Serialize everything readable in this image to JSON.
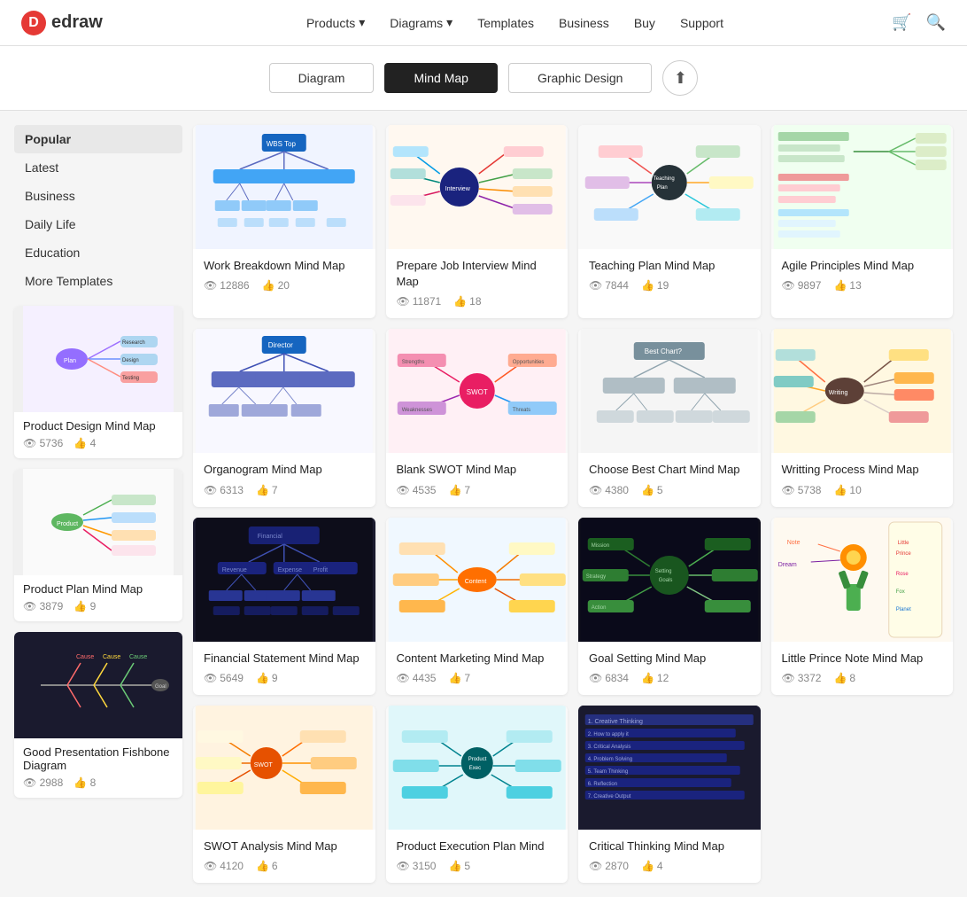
{
  "nav": {
    "logo": "edraw",
    "links": [
      {
        "label": "Products",
        "hasArrow": true
      },
      {
        "label": "Diagrams",
        "hasArrow": true
      },
      {
        "label": "Templates",
        "hasArrow": false
      },
      {
        "label": "Business",
        "hasArrow": false
      },
      {
        "label": "Buy",
        "hasArrow": false
      },
      {
        "label": "Support",
        "hasArrow": false
      }
    ]
  },
  "tabs": {
    "items": [
      {
        "label": "Diagram",
        "active": false
      },
      {
        "label": "Mind Map",
        "active": true
      },
      {
        "label": "Graphic Design",
        "active": false
      }
    ],
    "upload_title": "Upload"
  },
  "sidebar": {
    "items": [
      {
        "label": "Popular",
        "active": true
      },
      {
        "label": "Latest",
        "active": false
      },
      {
        "label": "Business",
        "active": false
      },
      {
        "label": "Daily Life",
        "active": false
      },
      {
        "label": "Education",
        "active": false
      },
      {
        "label": "More Templates",
        "active": false
      }
    ]
  },
  "side_cards": [
    {
      "title": "Product Design Mind Map",
      "views": "5736",
      "likes": "4",
      "bg": "light"
    },
    {
      "title": "Product Plan Mind Map",
      "views": "3879",
      "likes": "9",
      "bg": "light"
    },
    {
      "title": "Good Presentation Fishbone Diagram",
      "views": "2988",
      "likes": "8",
      "bg": "dark"
    }
  ],
  "cards": [
    {
      "title": "Work Breakdown Mind Map",
      "views": "12886",
      "likes": "20",
      "bg": "light",
      "color": "blue"
    },
    {
      "title": "Prepare Job Interview Mind Map",
      "views": "11871",
      "likes": "18",
      "bg": "light",
      "color": "multi"
    },
    {
      "title": "Teaching Plan Mind Map",
      "views": "7844",
      "likes": "19",
      "bg": "light",
      "color": "multi2"
    },
    {
      "title": "Agile Principles Mind Map",
      "views": "9897",
      "likes": "13",
      "bg": "light",
      "color": "green"
    },
    {
      "title": "Organogram Mind Map",
      "views": "6313",
      "likes": "7",
      "bg": "light",
      "color": "blue2"
    },
    {
      "title": "Blank SWOT Mind Map",
      "views": "4535",
      "likes": "7",
      "bg": "light",
      "color": "pink"
    },
    {
      "title": "Choose Best Chart Mind Map",
      "views": "4380",
      "likes": "5",
      "bg": "light",
      "color": "gray"
    },
    {
      "title": "Writting Process Mind Map",
      "views": "5738",
      "likes": "10",
      "bg": "light",
      "color": "multi3"
    },
    {
      "title": "Financial Statement Mind Map",
      "views": "5649",
      "likes": "9",
      "bg": "dark",
      "color": "dark"
    },
    {
      "title": "Content Marketing Mind Map",
      "views": "4435",
      "likes": "7",
      "bg": "light",
      "color": "multi4"
    },
    {
      "title": "Goal Setting Mind Map",
      "views": "6834",
      "likes": "12",
      "bg": "dark",
      "color": "dark2"
    },
    {
      "title": "Little Prince Note Mind Map",
      "views": "3372",
      "likes": "8",
      "bg": "light",
      "color": "pastel"
    },
    {
      "title": "SWOT Analysis Mind Map",
      "views": "4120",
      "likes": "6",
      "bg": "light",
      "color": "orange"
    },
    {
      "title": "Product Execution Plan Mind",
      "views": "3150",
      "likes": "5",
      "bg": "light",
      "color": "teal"
    },
    {
      "title": "Critical Thinking Mind Map",
      "views": "2870",
      "likes": "4",
      "bg": "dark",
      "color": "dark3"
    }
  ],
  "icons": {
    "eye": "👁",
    "like": "👍",
    "cart": "🛒",
    "search": "🔍",
    "upload": "⬆"
  }
}
